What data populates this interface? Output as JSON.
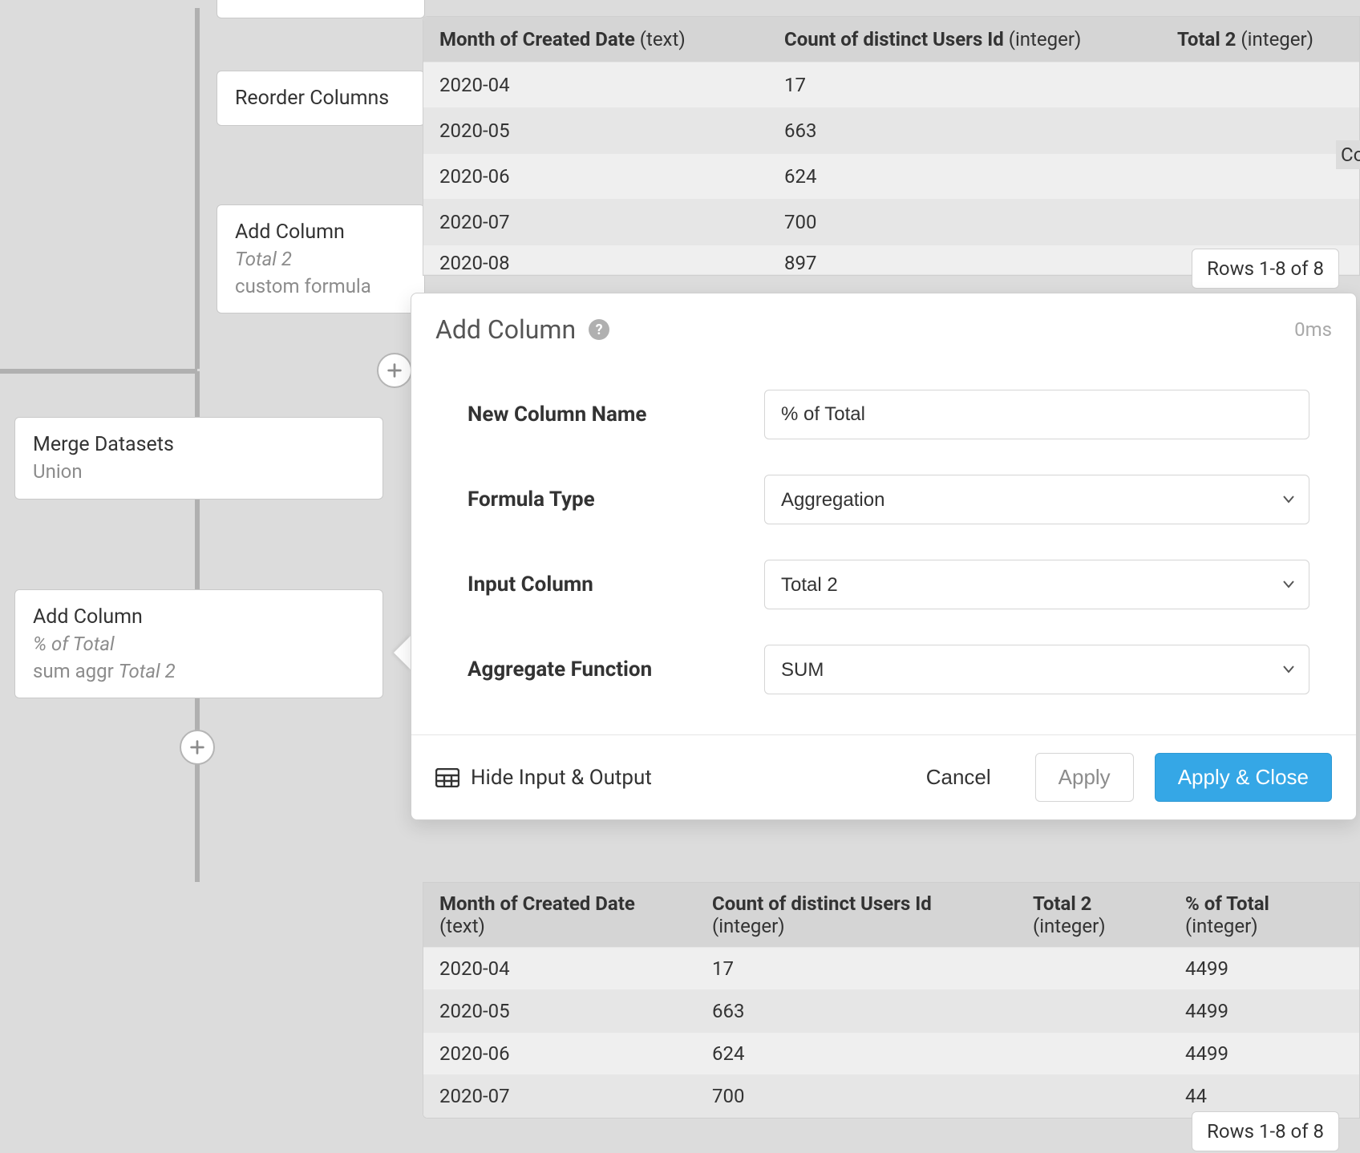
{
  "nodes": {
    "reorder": {
      "title": "Reorder Columns"
    },
    "addcol1": {
      "title": "Add Column",
      "sub": "Total 2",
      "sub2": "custom formula"
    },
    "merge": {
      "title": "Merge Datasets",
      "sub2": "Union"
    },
    "addcol2": {
      "title": "Add Column",
      "sub": "% of Total",
      "sub2_a": "sum aggr ",
      "sub2_b": "Total 2"
    }
  },
  "rightFragment": "Co",
  "topTable": {
    "headers": [
      {
        "name": "Month of Created Date",
        "type": "(text)"
      },
      {
        "name": "Count of distinct Users Id",
        "type": "(integer)"
      },
      {
        "name": "Total 2",
        "type": "(integer)"
      }
    ],
    "rows": [
      [
        "2020-04",
        "17",
        ""
      ],
      [
        "2020-05",
        "663",
        ""
      ],
      [
        "2020-06",
        "624",
        ""
      ],
      [
        "2020-07",
        "700",
        ""
      ],
      [
        "2020-08",
        "897",
        ""
      ]
    ],
    "rowsBadge": "Rows 1-8 of 8"
  },
  "panel": {
    "title": "Add Column",
    "timing": "0ms",
    "labels": {
      "newName": "New Column Name",
      "formulaType": "Formula Type",
      "inputColumn": "Input Column",
      "aggFn": "Aggregate Function"
    },
    "values": {
      "newName": "% of Total",
      "formulaType": "Aggregation",
      "inputColumn": "Total 2",
      "aggFn": "SUM"
    },
    "footer": {
      "hide": "Hide Input & Output",
      "cancel": "Cancel",
      "apply": "Apply",
      "applyClose": "Apply & Close"
    }
  },
  "bottomTable": {
    "headers": [
      {
        "name": "Month of Created Date",
        "type": "(text)"
      },
      {
        "name": "Count of distinct Users Id",
        "type": "(integer)"
      },
      {
        "name": "Total 2",
        "type": "(integer)"
      },
      {
        "name": "% of Total",
        "type": "(integer)"
      }
    ],
    "rows": [
      [
        "2020-04",
        "17",
        "",
        "4499"
      ],
      [
        "2020-05",
        "663",
        "",
        "4499"
      ],
      [
        "2020-06",
        "624",
        "",
        "4499"
      ],
      [
        "2020-07",
        "700",
        "",
        "44"
      ]
    ],
    "rowsBadge": "Rows 1-8 of 8"
  }
}
